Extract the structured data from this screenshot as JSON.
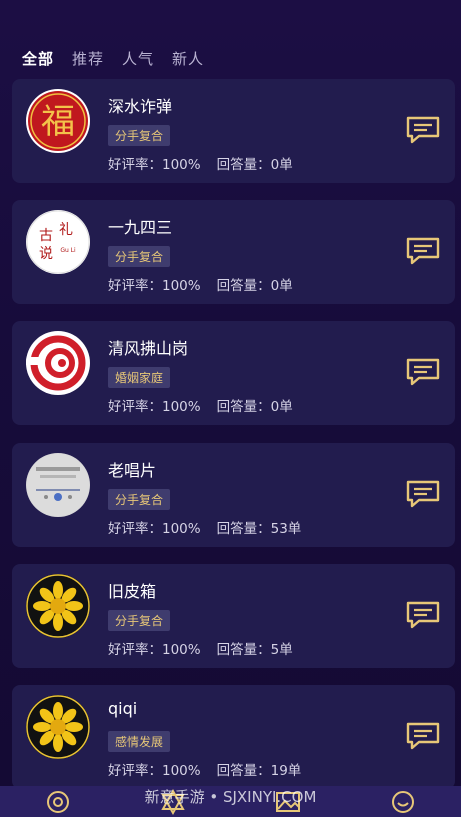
{
  "tabs": [
    {
      "label": "全部",
      "active": true
    },
    {
      "label": "推荐",
      "active": false
    },
    {
      "label": "人气",
      "active": false
    },
    {
      "label": "新人",
      "active": false
    }
  ],
  "cards": [
    {
      "name": "深水诈弹",
      "tag": "分手复合",
      "rating": "好评率：100%",
      "answers": "回答量：0单",
      "avatar_text": "福"
    },
    {
      "name": "一九四三",
      "tag": "分手复合",
      "rating": "好评率：100%",
      "answers": "回答量：0单",
      "avatar_text": "古礼\n说"
    },
    {
      "name": "清风拂山岗",
      "tag": "婚姻家庭",
      "rating": "好评率：100%",
      "answers": "回答量：0单"
    },
    {
      "name": "老唱片",
      "tag": "分手复合",
      "rating": "好评率：100%",
      "answers": "回答量：53单"
    },
    {
      "name": "旧皮箱",
      "tag": "分手复合",
      "rating": "好评率：100%",
      "answers": "回答量：5单"
    },
    {
      "name": "qiqi",
      "tag": "感情发展",
      "rating": "好评率：100%",
      "answers": "回答量：19单"
    }
  ],
  "watermark": "新意手游 • SJXINYI.COM",
  "colors": {
    "accent_gold": "#e7c778",
    "card_bg": "#221c4e",
    "tag_bg": "#3f3c6e",
    "nav_bg": "#2b2163"
  },
  "icons": {
    "chat": "chat-bubble-icon",
    "nav": [
      "eye-icon",
      "star-icon",
      "image-icon",
      "smile-icon"
    ]
  }
}
